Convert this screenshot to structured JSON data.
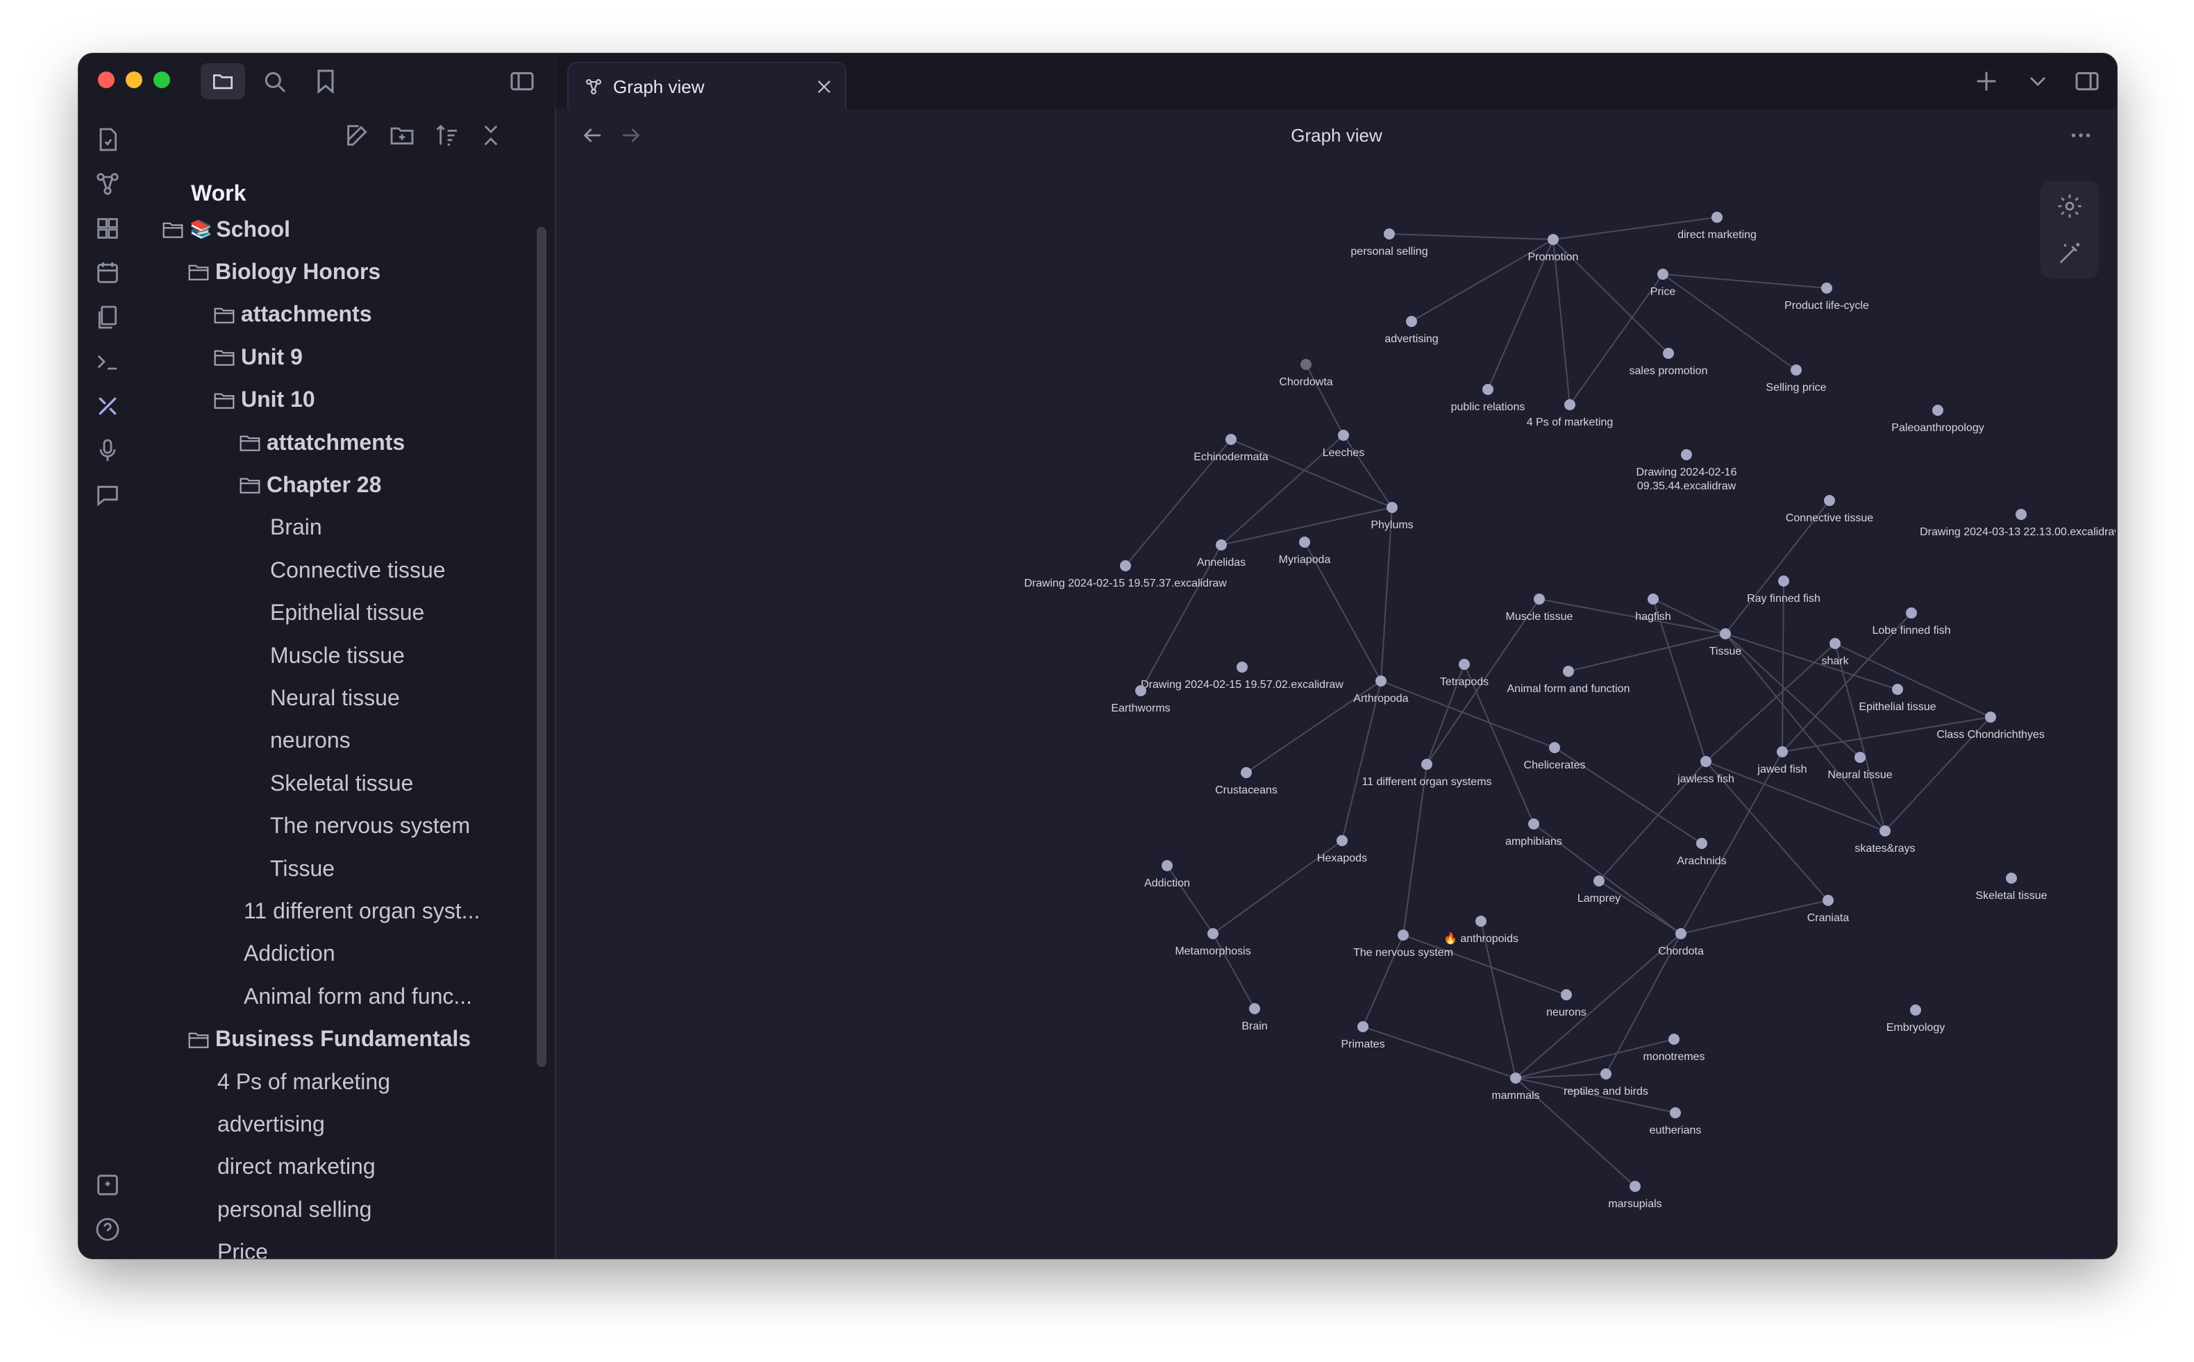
{
  "sidebar": {
    "vault_name": "Work",
    "tree": [
      {
        "label": "School",
        "type": "folder",
        "depth": 0,
        "emoji": "📚"
      },
      {
        "label": "Biology Honors",
        "type": "folder",
        "depth": 1
      },
      {
        "label": "attachments",
        "type": "folder",
        "depth": 2
      },
      {
        "label": "Unit 9",
        "type": "folder",
        "depth": 2
      },
      {
        "label": "Unit 10",
        "type": "folder",
        "depth": 2
      },
      {
        "label": "attatchments",
        "type": "folder",
        "depth": 3
      },
      {
        "label": "Chapter 28",
        "type": "folder",
        "depth": 3
      },
      {
        "label": "Brain",
        "type": "file",
        "depth": 4
      },
      {
        "label": "Connective tissue",
        "type": "file",
        "depth": 4
      },
      {
        "label": "Epithelial tissue",
        "type": "file",
        "depth": 4
      },
      {
        "label": "Muscle tissue",
        "type": "file",
        "depth": 4
      },
      {
        "label": "Neural tissue",
        "type": "file",
        "depth": 4
      },
      {
        "label": "neurons",
        "type": "file",
        "depth": 4
      },
      {
        "label": "Skeletal tissue",
        "type": "file",
        "depth": 4
      },
      {
        "label": "The nervous system",
        "type": "file",
        "depth": 4
      },
      {
        "label": "Tissue",
        "type": "file",
        "depth": 4
      },
      {
        "label": "11 different organ syst...",
        "type": "file",
        "depth": 3
      },
      {
        "label": "Addiction",
        "type": "file",
        "depth": 3
      },
      {
        "label": "Animal form and func...",
        "type": "file",
        "depth": 3
      },
      {
        "label": "Business Fundamentals",
        "type": "folder",
        "depth": 1
      },
      {
        "label": "4 Ps of marketing",
        "type": "file",
        "depth": 2
      },
      {
        "label": "advertising",
        "type": "file",
        "depth": 2
      },
      {
        "label": "direct marketing",
        "type": "file",
        "depth": 2
      },
      {
        "label": "personal selling",
        "type": "file",
        "depth": 2
      },
      {
        "label": "Price",
        "type": "file",
        "depth": 2
      }
    ]
  },
  "tab": {
    "title": "Graph view"
  },
  "view": {
    "title": "Graph view"
  },
  "graph": {
    "nodes": [
      {
        "id": "personal-selling",
        "label": "personal selling"
      },
      {
        "id": "promotion",
        "label": "Promotion"
      },
      {
        "id": "direct-marketing",
        "label": "direct marketing"
      },
      {
        "id": "price",
        "label": "Price"
      },
      {
        "id": "product-life-cycle",
        "label": "Product life-cycle"
      },
      {
        "id": "advertising",
        "label": "advertising"
      },
      {
        "id": "sales-promotion",
        "label": "sales promotion"
      },
      {
        "id": "selling-price",
        "label": "Selling price"
      },
      {
        "id": "public-relations",
        "label": "public relations"
      },
      {
        "id": "4ps",
        "label": "4 Ps of marketing"
      },
      {
        "id": "paleo",
        "label": "Paleoanthropology"
      },
      {
        "id": "chordowta",
        "label": "Chordowta"
      },
      {
        "id": "echinodermata",
        "label": "Echinodermata"
      },
      {
        "id": "leeches",
        "label": "Leeches"
      },
      {
        "id": "drawing-0216",
        "label": "Drawing 2024-02-16\n09.35.44.excalidraw"
      },
      {
        "id": "connective",
        "label": "Connective tissue"
      },
      {
        "id": "drawing-0313",
        "label": "Drawing 2024-03-13 22.13.00.excalidraw"
      },
      {
        "id": "phylums",
        "label": "Phylums"
      },
      {
        "id": "annelidas",
        "label": "Annelidas"
      },
      {
        "id": "myriapoda",
        "label": "Myriapoda"
      },
      {
        "id": "drawing-0215a",
        "label": "Drawing 2024-02-15 19.57.37.excalidraw"
      },
      {
        "id": "muscle",
        "label": "Muscle tissue"
      },
      {
        "id": "hagfish",
        "label": "hagfish"
      },
      {
        "id": "ray-finned",
        "label": "Ray finned fish"
      },
      {
        "id": "lobe-finned",
        "label": "Lobe finned fish"
      },
      {
        "id": "tissue",
        "label": "Tissue"
      },
      {
        "id": "shark",
        "label": "shark"
      },
      {
        "id": "tetrapods",
        "label": "Tetrapods"
      },
      {
        "id": "animal-form",
        "label": "Animal form and function"
      },
      {
        "id": "drawing-0215b",
        "label": "Drawing 2024-02-15 19.57.02.excalidraw"
      },
      {
        "id": "arthropoda",
        "label": "Arthropoda"
      },
      {
        "id": "earthworms",
        "label": "Earthworms"
      },
      {
        "id": "epithelial",
        "label": "Epithelial tissue"
      },
      {
        "id": "class-chondrichthyes",
        "label": "Class Chondrichthyes"
      },
      {
        "id": "crustaceans",
        "label": "Crustaceans"
      },
      {
        "id": "organ-systems",
        "label": "11 different organ systems"
      },
      {
        "id": "chelicerates",
        "label": "Chelicerates"
      },
      {
        "id": "jawless",
        "label": "jawless fish"
      },
      {
        "id": "jawed",
        "label": "jawed fish"
      },
      {
        "id": "neural",
        "label": "Neural tissue"
      },
      {
        "id": "amphibians",
        "label": "amphibians"
      },
      {
        "id": "skates",
        "label": "skates&rays"
      },
      {
        "id": "hexapods",
        "label": "Hexapods"
      },
      {
        "id": "arachnids",
        "label": "Arachnids"
      },
      {
        "id": "addiction",
        "label": "Addiction"
      },
      {
        "id": "skeletal",
        "label": "Skeletal tissue"
      },
      {
        "id": "lamprey",
        "label": "Lamprey"
      },
      {
        "id": "craniata",
        "label": "Craniata"
      },
      {
        "id": "anthropoids",
        "label": "🔥 anthropoids"
      },
      {
        "id": "metamorphosis",
        "label": "Metamorphosis"
      },
      {
        "id": "nervous-system",
        "label": "The nervous system"
      },
      {
        "id": "chordota",
        "label": "Chordota"
      },
      {
        "id": "neurons",
        "label": "neurons"
      },
      {
        "id": "embryology",
        "label": "Embryology"
      },
      {
        "id": "brain",
        "label": "Brain"
      },
      {
        "id": "primates",
        "label": "Primates"
      },
      {
        "id": "monotremes",
        "label": "monotremes"
      },
      {
        "id": "mammals",
        "label": "mammals"
      },
      {
        "id": "reptiles",
        "label": "reptiles and birds"
      },
      {
        "id": "eutherians",
        "label": "eutherians"
      },
      {
        "id": "marsupials",
        "label": "marsupials"
      }
    ],
    "edges": [
      [
        "personal-selling",
        "promotion"
      ],
      [
        "promotion",
        "direct-marketing"
      ],
      [
        "promotion",
        "advertising"
      ],
      [
        "promotion",
        "public-relations"
      ],
      [
        "promotion",
        "4ps"
      ],
      [
        "promotion",
        "sales-promotion"
      ],
      [
        "price",
        "product-life-cycle"
      ],
      [
        "price",
        "selling-price"
      ],
      [
        "price",
        "4ps"
      ],
      [
        "chordowta",
        "leeches"
      ],
      [
        "leeches",
        "phylums"
      ],
      [
        "leeches",
        "annelidas"
      ],
      [
        "echinodermata",
        "phylums"
      ],
      [
        "echinodermata",
        "drawing-0215a"
      ],
      [
        "annelidas",
        "phylums"
      ],
      [
        "annelidas",
        "earthworms"
      ],
      [
        "myriapoda",
        "arthropoda"
      ],
      [
        "phylums",
        "arthropoda"
      ],
      [
        "arthropoda",
        "crustaceans"
      ],
      [
        "arthropoda",
        "hexapods"
      ],
      [
        "arthropoda",
        "chelicerates"
      ],
      [
        "hexapods",
        "metamorphosis"
      ],
      [
        "metamorphosis",
        "addiction"
      ],
      [
        "metamorphosis",
        "brain"
      ],
      [
        "chelicerates",
        "arachnids"
      ],
      [
        "tetrapods",
        "amphibians"
      ],
      [
        "tetrapods",
        "organ-systems"
      ],
      [
        "muscle",
        "organ-systems"
      ],
      [
        "muscle",
        "tissue"
      ],
      [
        "hagfish",
        "tissue"
      ],
      [
        "animal-form",
        "tissue"
      ],
      [
        "connective",
        "tissue"
      ],
      [
        "tissue",
        "epithelial"
      ],
      [
        "tissue",
        "neural"
      ],
      [
        "tissue",
        "skates"
      ],
      [
        "hagfish",
        "jawless"
      ],
      [
        "ray-finned",
        "jawed"
      ],
      [
        "shark",
        "jawless"
      ],
      [
        "shark",
        "skates"
      ],
      [
        "shark",
        "class-chondrichthyes"
      ],
      [
        "lobe-finned",
        "jawed"
      ],
      [
        "class-chondrichthyes",
        "jawed"
      ],
      [
        "class-chondrichthyes",
        "skates"
      ],
      [
        "jawless",
        "lamprey"
      ],
      [
        "jawless",
        "craniata"
      ],
      [
        "jawless",
        "skates"
      ],
      [
        "jawed",
        "chordota"
      ],
      [
        "lamprey",
        "chordota"
      ],
      [
        "chordota",
        "craniata"
      ],
      [
        "chordota",
        "amphibians"
      ],
      [
        "chordota",
        "mammals"
      ],
      [
        "chordota",
        "reptiles"
      ],
      [
        "organ-systems",
        "nervous-system"
      ],
      [
        "nervous-system",
        "neurons"
      ],
      [
        "anthropoids",
        "mammals"
      ],
      [
        "primates",
        "mammals"
      ],
      [
        "primates",
        "nervous-system"
      ],
      [
        "mammals",
        "monotremes"
      ],
      [
        "mammals",
        "eutherians"
      ],
      [
        "mammals",
        "marsupials"
      ],
      [
        "mammals",
        "reptiles"
      ]
    ]
  }
}
